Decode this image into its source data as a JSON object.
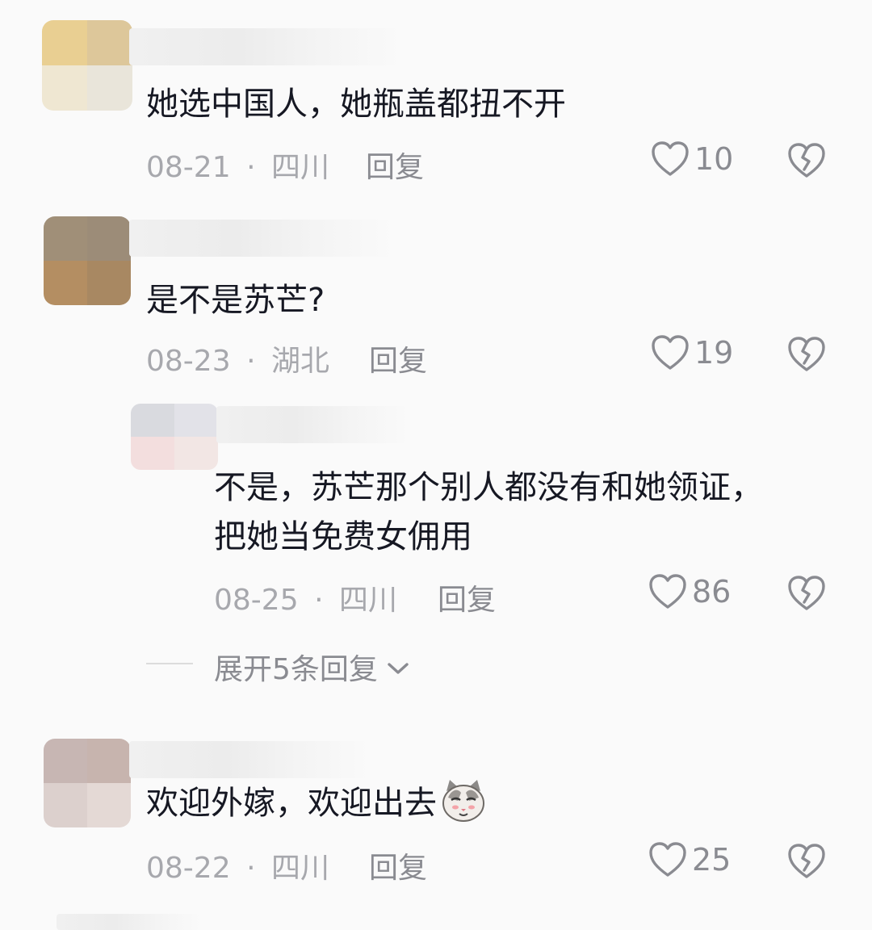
{
  "comments": [
    {
      "text": "她选中国人，她瓶盖都扭不开",
      "date": "08-21",
      "sep": "·",
      "location": "四川",
      "reply_label": "回复",
      "likes": "10"
    },
    {
      "text": "是不是苏芒?",
      "date": "08-23",
      "sep": "·",
      "location": "湖北",
      "reply_label": "回复",
      "likes": "19"
    },
    {
      "text": "欢迎外嫁，欢迎出去",
      "date": "08-22",
      "sep": "·",
      "location": "四川",
      "reply_label": "回复",
      "likes": "25"
    }
  ],
  "reply": {
    "text_line1": "不是，苏芒那个别人都没有和她领证，",
    "text_line2": "把她当免费女佣用",
    "date": "08-25",
    "sep": "·",
    "location": "四川",
    "reply_label": "回复",
    "likes": "86"
  },
  "expand_replies_label": "展开5条回复",
  "icons": {
    "like": "heart-outline-icon",
    "dislike": "broken-heart-icon",
    "expand": "chevron-down-icon",
    "emoji": "cat-face-emoji"
  },
  "colors": {
    "text": "#161823",
    "meta": "#a7a8ad",
    "action": "#8a8b91"
  }
}
